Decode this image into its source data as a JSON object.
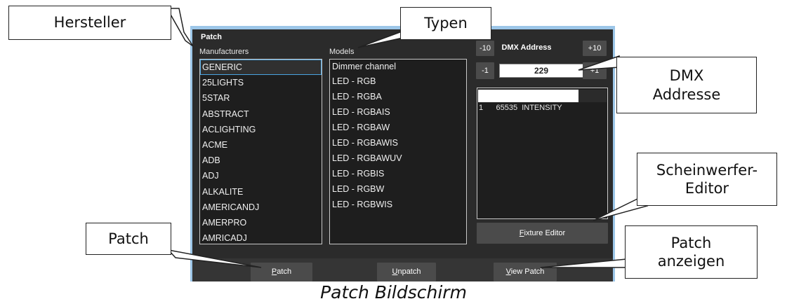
{
  "window": {
    "title": "Patch",
    "manufacturers_label": "Manufacturers",
    "models_label": "Models",
    "manufacturers": [
      "GENERIC",
      "25LIGHTS",
      "5STAR",
      "ABSTRACT",
      "ACLIGHTING",
      "ACME",
      "ADB",
      "ADJ",
      "ALKALITE",
      "AMERICANDJ",
      "AMERPRO",
      "AMRICADJ"
    ],
    "selected_manufacturer": "GENERIC",
    "models": [
      "Dimmer channel",
      "LED - RGB",
      "LED - RGBA",
      "LED - RGBAIS",
      "LED - RGBAW",
      "LED - RGBAWIS",
      "LED - RGBAWUV",
      "LED - RGBIS",
      "LED - RGBW",
      "LED - RGBWIS"
    ],
    "dmx": {
      "title": "DMX Address",
      "minus10": "-10",
      "plus10": "+10",
      "minus1": "-1",
      "plus1": "+1",
      "address": "229"
    },
    "channels": [
      {
        "num": "1",
        "value": "65535",
        "name": "INTENSITY"
      }
    ],
    "fixture_editor": {
      "prefix": "",
      "mnemonic": "F",
      "rest": "ixture Editor"
    },
    "bottom_buttons": {
      "patch": {
        "mnemonic": "P",
        "rest": "atch"
      },
      "unpatch": {
        "mnemonic": "U",
        "rest": "npatch"
      },
      "view_patch": {
        "mnemonic": "V",
        "rest": "iew Patch"
      }
    }
  },
  "callouts": {
    "hersteller": "Hersteller",
    "typen": "Typen",
    "dmx_line1": "DMX",
    "dmx_line2": "Addresse",
    "scheinwerfer_line1": "Scheinwerfer-",
    "scheinwerfer_line2": "Editor",
    "patch": "Patch",
    "patch_anzeigen_line1": "Patch",
    "patch_anzeigen_line2": "anzeigen"
  },
  "caption": "Patch Bildschirm",
  "colors": {
    "window_bg": "#2b2b2b",
    "window_border": "#9cc6e8",
    "selection_border": "#4aa3e0",
    "button_bg": "#4b4b4b"
  }
}
